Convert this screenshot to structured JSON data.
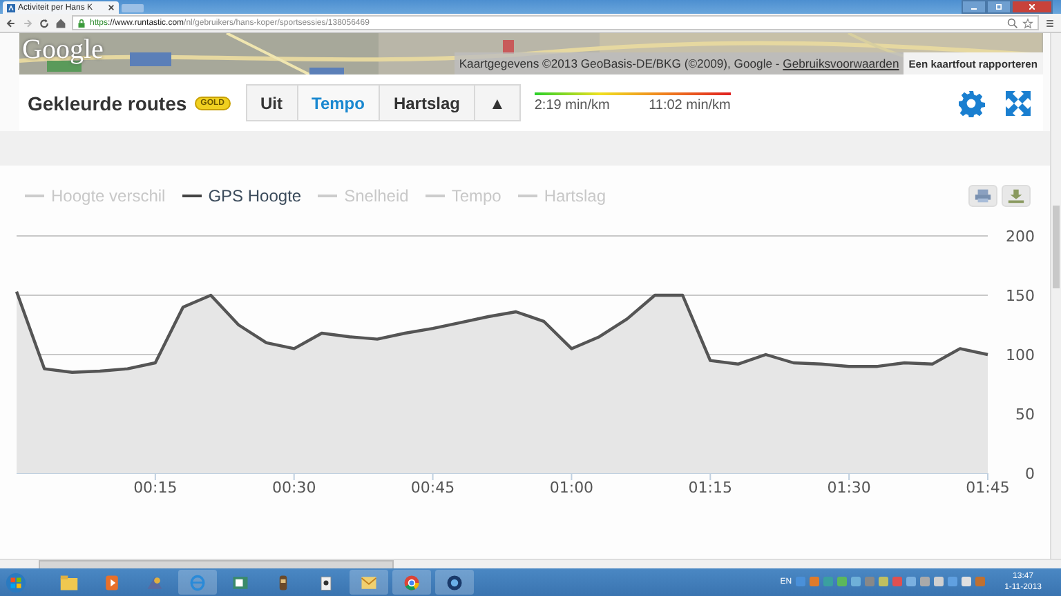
{
  "browser": {
    "tab_title": "Activiteit per Hans K",
    "url_scheme": "https",
    "url_host": "://www.runtastic.com",
    "url_path": "/nl/gebruikers/hans-koper/sportsessies/138056469"
  },
  "map": {
    "logo": "Google",
    "attribution": "Kaartgegevens ©2013 GeoBasis-DE/BKG (©2009), Google - ",
    "terms_link": "Gebruiksvoorwaarden",
    "report_button": "Een kaartfout rapporteren"
  },
  "route_colors": {
    "title": "Gekleurde routes",
    "badge": "GOLD",
    "options": [
      {
        "label": "Uit",
        "selected": false
      },
      {
        "label": "Tempo",
        "selected": true
      },
      {
        "label": "Hartslag",
        "selected": false
      },
      {
        "label": "▲",
        "selected": false
      }
    ],
    "scale_min": "2:19 min/km",
    "scale_max": "11:02 min/km"
  },
  "chart": {
    "legend": [
      {
        "label": "Hoogte verschil",
        "selected": false
      },
      {
        "kind": "series",
        "selected": true
      },
      {
        "label": "Snelheid",
        "selected": false
      },
      {
        "label": "Tempo",
        "selected": false
      },
      {
        "label": "Hartslag",
        "selected": false
      }
    ],
    "chart_data": {
      "type": "area",
      "x": [
        0,
        3,
        6,
        9,
        12,
        15,
        18,
        21,
        24,
        27,
        30,
        33,
        36,
        39,
        42,
        45,
        48,
        51,
        54,
        57,
        60,
        63,
        66,
        69,
        72,
        75,
        78,
        81,
        84,
        87,
        90,
        93,
        96,
        99,
        102,
        105
      ],
      "series": [
        {
          "name": "GPS Hoogte",
          "color": "#555555",
          "values": [
            153,
            88,
            85,
            86,
            88,
            93,
            140,
            150,
            125,
            110,
            105,
            118,
            115,
            113,
            118,
            122,
            127,
            132,
            136,
            128,
            105,
            115,
            130,
            150,
            150,
            95,
            92,
            100,
            93,
            92,
            90,
            90,
            93,
            92,
            105,
            100
          ]
        }
      ],
      "xlim": [
        0,
        105
      ],
      "ylim": [
        0,
        200
      ],
      "grid": true,
      "xticks": [
        {
          "value": 15,
          "label": "00:15"
        },
        {
          "value": 30,
          "label": "00:30"
        },
        {
          "value": 45,
          "label": "00:45"
        },
        {
          "value": 60,
          "label": "01:00"
        },
        {
          "value": 75,
          "label": "01:15"
        },
        {
          "value": 90,
          "label": "01:30"
        },
        {
          "value": 105,
          "label": "01:45"
        }
      ],
      "yticks": [
        0,
        50,
        100,
        150,
        200
      ]
    }
  },
  "taskbar": {
    "language": "EN",
    "time": "13:47",
    "date": "1-11-2013"
  }
}
